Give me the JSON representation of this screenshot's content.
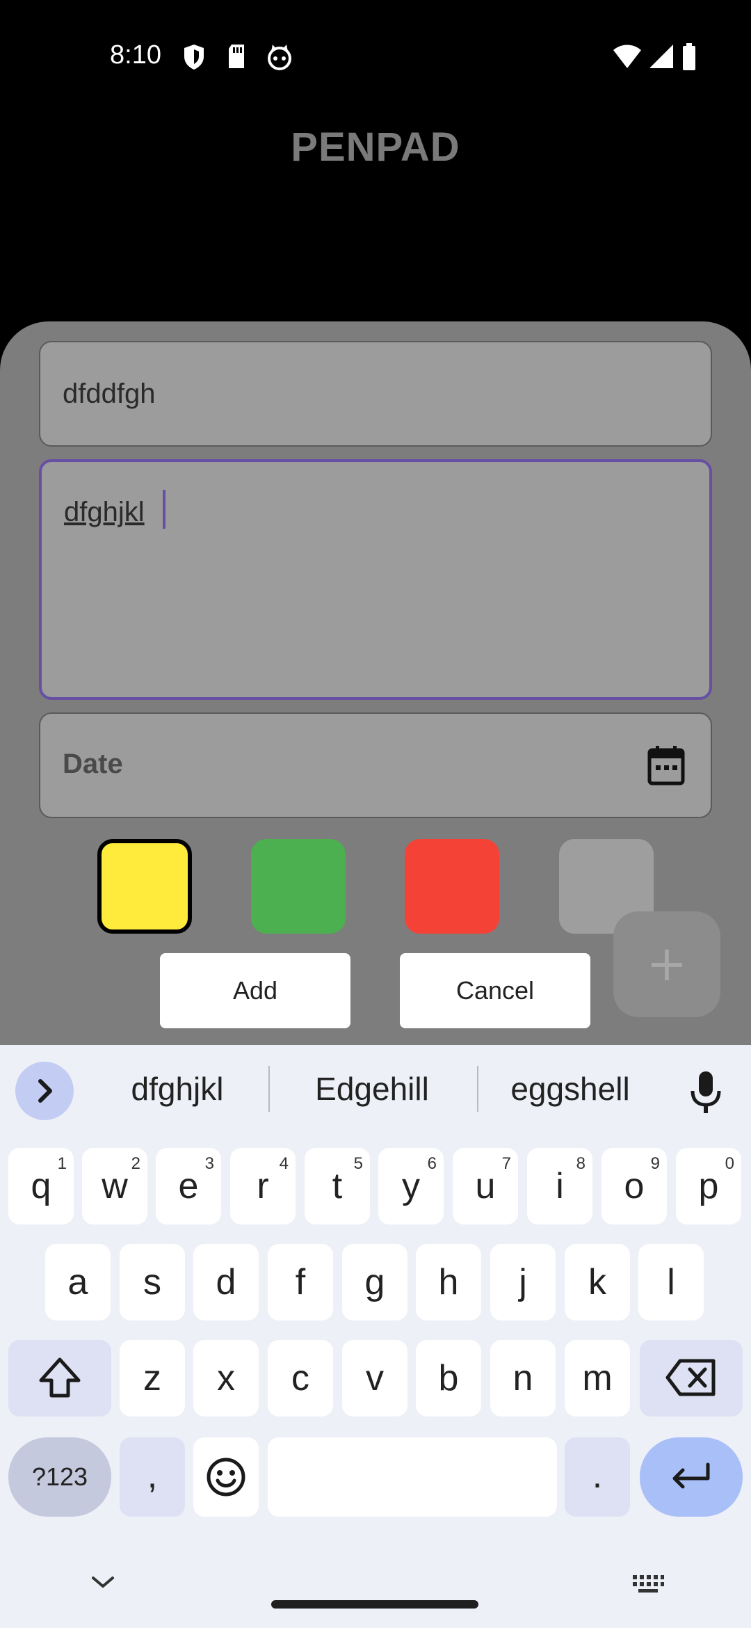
{
  "status": {
    "time": "8:10"
  },
  "app": {
    "title": "PENPAD"
  },
  "form": {
    "title_value": "dfddfgh",
    "description_value": "dfghjkl",
    "date_placeholder": "Date",
    "add_label": "Add",
    "cancel_label": "Cancel",
    "fab_label": "+",
    "colors": [
      "#ffeb3b",
      "#4caf50",
      "#f44336",
      "#9e9e9e"
    ],
    "selected_color": "#ffeb3b"
  },
  "keyboard": {
    "suggestions": [
      "dfghjkl",
      "Edgehill",
      "eggshell"
    ],
    "row1": [
      "q",
      "w",
      "e",
      "r",
      "t",
      "y",
      "u",
      "i",
      "o",
      "p"
    ],
    "row1_hints": [
      "1",
      "2",
      "3",
      "4",
      "5",
      "6",
      "7",
      "8",
      "9",
      "0"
    ],
    "row2": [
      "a",
      "s",
      "d",
      "f",
      "g",
      "h",
      "j",
      "k",
      "l"
    ],
    "row3": [
      "z",
      "x",
      "c",
      "v",
      "b",
      "n",
      "m"
    ],
    "symbols_label": "?123",
    "comma": ",",
    "period": "."
  },
  "icons": {
    "status": [
      "shield-icon",
      "sd-card-icon",
      "cat-icon",
      "wifi-icon",
      "signal-icon",
      "battery-icon"
    ],
    "date": "calendar-icon",
    "suggest_expand": "chevron-right-icon",
    "voice": "mic-icon",
    "shift": "shift-icon",
    "backspace": "backspace-icon",
    "emoji": "emoji-icon",
    "enter": "enter-icon",
    "nav": [
      "chevron-down-icon",
      "keyboard-icon"
    ]
  },
  "colors": {
    "accent": "#6750a4",
    "sheet": "#7d7d7d",
    "field": "#9c9c9c",
    "keyboard_bg": "#eef0f7"
  }
}
